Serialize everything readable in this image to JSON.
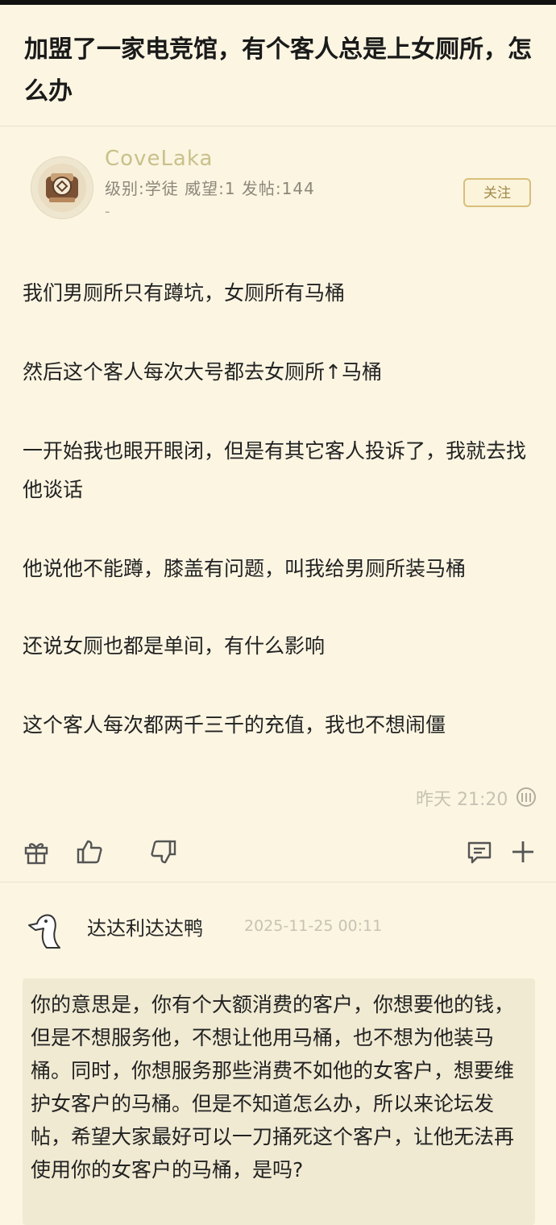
{
  "post": {
    "title": "加盟了一家电竞馆，有个客人总是上女厕所，怎么办",
    "author": {
      "name": "CoveLaka",
      "stats": "级别:学徒 威望:1 发帖:144",
      "extra": "-"
    },
    "follow_label": "关注",
    "paragraphs": [
      "我们男厕所只有蹲坑，女厕所有马桶",
      "然后这个客人每次大号都去女厕所↑马桶",
      "一开始我也眼开眼闭，但是有其它客人投诉了，我就去找他谈话",
      "他说他不能蹲，膝盖有问题，叫我给男厕所装马桶",
      "还说女厕也都是单间，有什么影响",
      "这个客人每次都两千三千的充值，我也不想闹僵"
    ],
    "time": "昨天 21:20"
  },
  "icons": {
    "gift": "gift-icon",
    "like": "thumbs-up-icon",
    "dislike": "thumbs-down-icon",
    "comment": "comment-icon",
    "plus": "plus-icon",
    "time_icon": "badge-icon"
  },
  "reply": {
    "author": "达达利达达鸭",
    "time": "2025-11-25 00:11",
    "text": "你的意思是，你有个大额消费的客户，你想要他的钱，但是不想服务他，不想让他用马桶，也不想为他装马桶。同时，你想服务那些消费不如他的女客户，想要维护女客户的马桶。但是不知道怎么办，所以来论坛发帖，希望大家最好可以一刀捅死这个客户，让他无法再使用你的女客户的马桶，是吗?"
  },
  "colors": {
    "background": "#fbf5e2",
    "accent": "#d8bf7a",
    "username": "#c9c08a"
  }
}
